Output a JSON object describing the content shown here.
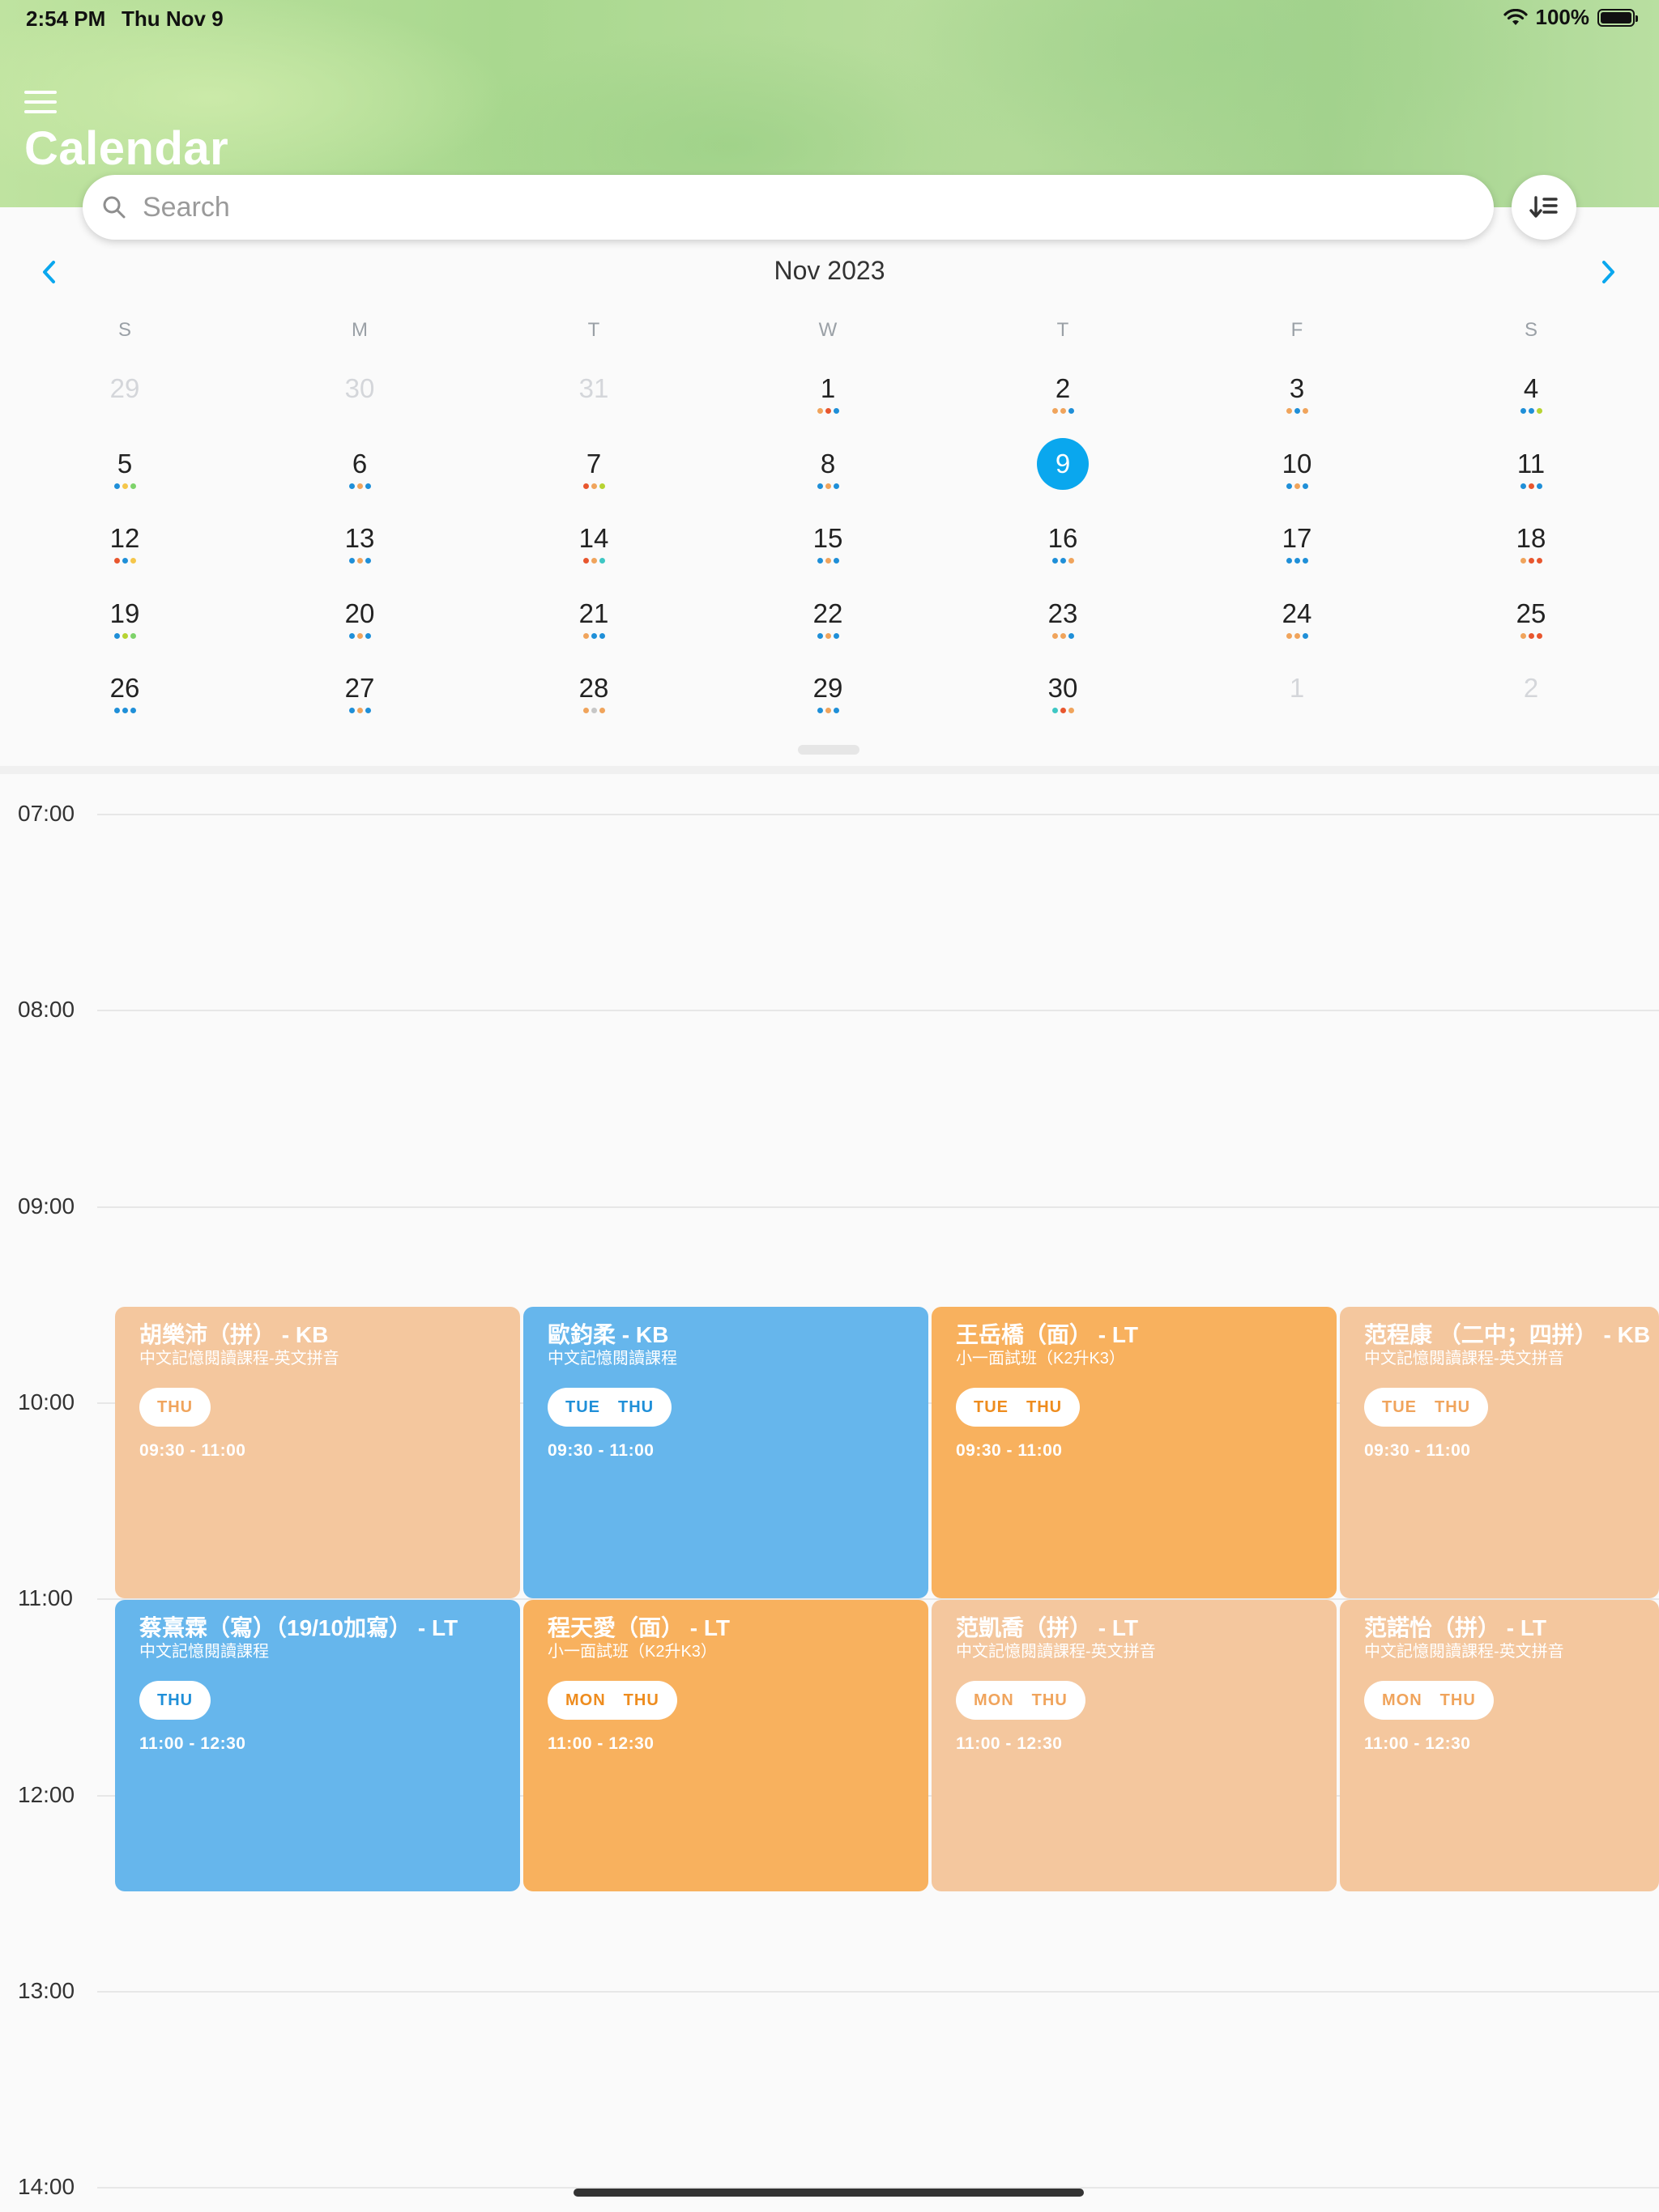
{
  "status_bar": {
    "time": "2:54 PM",
    "date": "Thu Nov 9",
    "battery": "100%"
  },
  "header": {
    "title": "Calendar"
  },
  "search": {
    "placeholder": "Search"
  },
  "calendar": {
    "month_label": "Nov 2023",
    "weekdays": [
      "S",
      "M",
      "T",
      "W",
      "T",
      "F",
      "S"
    ],
    "weeks": [
      [
        {
          "d": "29",
          "o": true
        },
        {
          "d": "30",
          "o": true
        },
        {
          "d": "31",
          "o": true
        },
        {
          "d": "1",
          "dots": [
            "#f0a45c",
            "#e8562e",
            "#1f8fd8"
          ]
        },
        {
          "d": "2",
          "dots": [
            "#f0a45c",
            "#f0a45c",
            "#1f8fd8"
          ]
        },
        {
          "d": "3",
          "dots": [
            "#f0a45c",
            "#1f8fd8",
            "#f0a45c"
          ]
        },
        {
          "d": "4",
          "dots": [
            "#1f8fd8",
            "#1f8fd8",
            "#b7d332"
          ]
        }
      ],
      [
        {
          "d": "5",
          "dots": [
            "#1f8fd8",
            "#f5c64a",
            "#7ed36a"
          ]
        },
        {
          "d": "6",
          "dots": [
            "#1f8fd8",
            "#f0a45c",
            "#1f8fd8"
          ]
        },
        {
          "d": "7",
          "dots": [
            "#e8562e",
            "#f0a45c",
            "#b7d332"
          ]
        },
        {
          "d": "8",
          "dots": [
            "#1f8fd8",
            "#f0a45c",
            "#1f8fd8"
          ]
        },
        {
          "d": "9",
          "today": true
        },
        {
          "d": "10",
          "dots": [
            "#1f8fd8",
            "#f0a45c",
            "#1f8fd8"
          ]
        },
        {
          "d": "11",
          "dots": [
            "#1f8fd8",
            "#e8562e",
            "#1f8fd8"
          ]
        }
      ],
      [
        {
          "d": "12",
          "dots": [
            "#e8562e",
            "#1f8fd8",
            "#f5c64a"
          ]
        },
        {
          "d": "13",
          "dots": [
            "#1f8fd8",
            "#f0a45c",
            "#1f8fd8"
          ]
        },
        {
          "d": "14",
          "dots": [
            "#e8562e",
            "#f0a45c",
            "#3ec7c4"
          ]
        },
        {
          "d": "15",
          "dots": [
            "#1f8fd8",
            "#f0a45c",
            "#1f8fd8"
          ]
        },
        {
          "d": "16",
          "dots": [
            "#1f8fd8",
            "#1f8fd8",
            "#f0a45c"
          ]
        },
        {
          "d": "17",
          "dots": [
            "#1f8fd8",
            "#1f8fd8",
            "#1f8fd8"
          ]
        },
        {
          "d": "18",
          "dots": [
            "#f0a45c",
            "#e8562e",
            "#e8562e"
          ]
        }
      ],
      [
        {
          "d": "19",
          "dots": [
            "#1f8fd8",
            "#b7d332",
            "#7ed36a"
          ]
        },
        {
          "d": "20",
          "dots": [
            "#1f8fd8",
            "#f0a45c",
            "#1f8fd8"
          ]
        },
        {
          "d": "21",
          "dots": [
            "#f0a45c",
            "#1f8fd8",
            "#1f8fd8"
          ]
        },
        {
          "d": "22",
          "dots": [
            "#1f8fd8",
            "#f0a45c",
            "#1f8fd8"
          ]
        },
        {
          "d": "23",
          "dots": [
            "#f0a45c",
            "#f0a45c",
            "#1f8fd8"
          ]
        },
        {
          "d": "24",
          "dots": [
            "#f0a45c",
            "#f0a45c",
            "#1f8fd8"
          ]
        },
        {
          "d": "25",
          "dots": [
            "#f0a45c",
            "#e8562e",
            "#e8562e"
          ]
        }
      ],
      [
        {
          "d": "26",
          "dots": [
            "#1f8fd8",
            "#1f8fd8",
            "#1f8fd8"
          ]
        },
        {
          "d": "27",
          "dots": [
            "#1f8fd8",
            "#f0a45c",
            "#1f8fd8"
          ]
        },
        {
          "d": "28",
          "dots": [
            "#f0a45c",
            "#c7c7c7",
            "#f0a45c"
          ]
        },
        {
          "d": "29",
          "dots": [
            "#1f8fd8",
            "#f0a45c",
            "#1f8fd8"
          ]
        },
        {
          "d": "30",
          "dots": [
            "#3ec7c4",
            "#e8562e",
            "#f0a45c"
          ]
        },
        {
          "d": "1",
          "o": true
        },
        {
          "d": "2",
          "o": true
        }
      ]
    ]
  },
  "timeline": {
    "hours": [
      "07:00",
      "08:00",
      "09:00",
      "10:00",
      "11:00",
      "12:00",
      "13:00",
      "14:00"
    ],
    "events": [
      {
        "title": "胡樂沛（拼） - KB",
        "subtitle": "中文記憶閱讀課程-英文拼音",
        "days": [
          "THU"
        ],
        "time": "09:30 - 11:00",
        "color": "peach",
        "row": 0,
        "col": 0
      },
      {
        "title": "歐鈞柔 - KB",
        "subtitle": "中文記憶閱讀課程",
        "days": [
          "TUE",
          "THU"
        ],
        "time": "09:30 - 11:00",
        "color": "blue",
        "row": 0,
        "col": 1
      },
      {
        "title": "王岳橋（面） - LT",
        "subtitle": "小一面試班（K2升K3）",
        "days": [
          "TUE",
          "THU"
        ],
        "time": "09:30 - 11:00",
        "color": "orange",
        "row": 0,
        "col": 2
      },
      {
        "title": "范程康 （二中；四拼） - KB",
        "subtitle": "中文記憶閱讀課程-英文拼音",
        "days": [
          "TUE",
          "THU"
        ],
        "time": "09:30 - 11:00",
        "color": "peach",
        "row": 0,
        "col": 3
      },
      {
        "title": "蔡熹霖（寫）（19/10加寫） - LT",
        "subtitle": "中文記憶閱讀課程",
        "days": [
          "THU"
        ],
        "time": "11:00 - 12:30",
        "color": "blue",
        "row": 1,
        "col": 0
      },
      {
        "title": "程天愛（面） - LT",
        "subtitle": "小一面試班（K2升K3）",
        "days": [
          "MON",
          "THU"
        ],
        "time": "11:00 - 12:30",
        "color": "orange",
        "row": 1,
        "col": 1
      },
      {
        "title": "范凱喬（拼） - LT",
        "subtitle": "中文記憶閱讀課程-英文拼音",
        "days": [
          "MON",
          "THU"
        ],
        "time": "11:00 - 12:30",
        "color": "peach",
        "row": 1,
        "col": 2
      },
      {
        "title": "范諾怡（拼） - LT",
        "subtitle": "中文記憶閱讀課程-英文拼音",
        "days": [
          "MON",
          "THU"
        ],
        "time": "11:00 - 12:30",
        "color": "peach",
        "row": 1,
        "col": 3
      }
    ]
  }
}
